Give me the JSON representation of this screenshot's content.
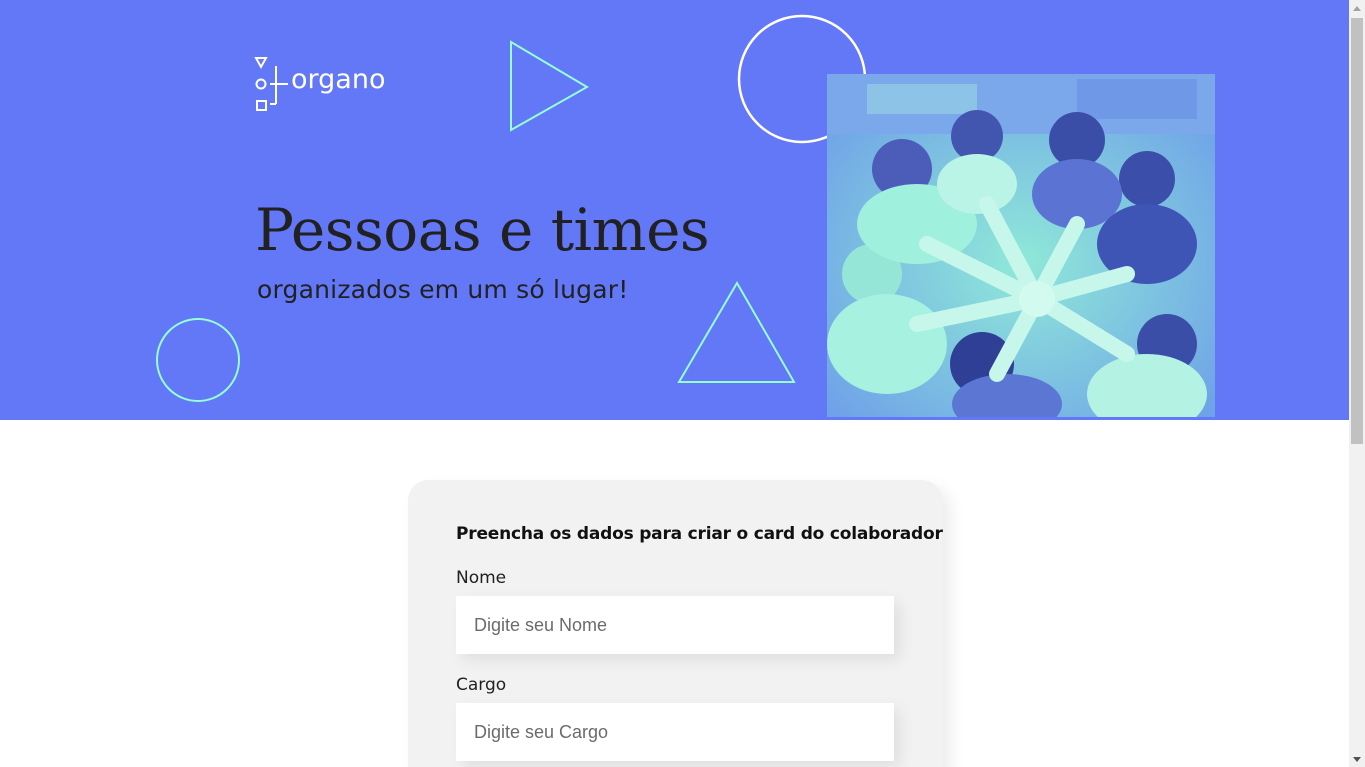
{
  "banner": {
    "logo_text": "organo",
    "headline": "Pessoas e times",
    "subheadline": "organizados em um só lugar!",
    "background_color": "#6278f7",
    "accent_color": "#95ffd4",
    "photo_description_icon": "team-hands-photo"
  },
  "form": {
    "title": "Preencha os dados para criar o card do colaborador",
    "fields": [
      {
        "label": "Nome",
        "placeholder": "Digite seu Nome",
        "value": ""
      },
      {
        "label": "Cargo",
        "placeholder": "Digite seu Cargo",
        "value": ""
      }
    ]
  }
}
